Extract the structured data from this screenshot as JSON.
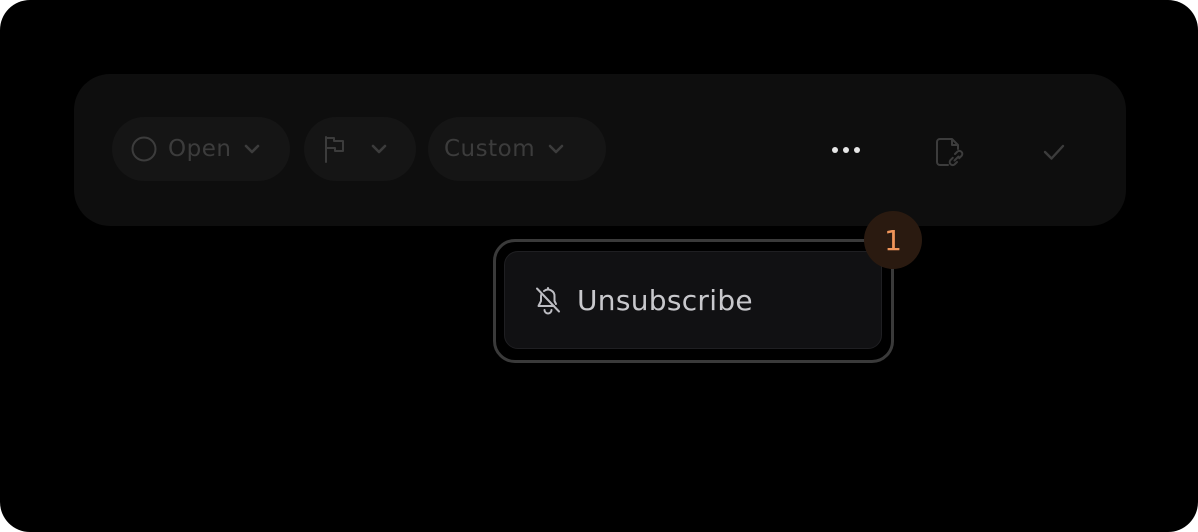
{
  "toolbar": {
    "status_label": "Open",
    "custom_label": "Custom"
  },
  "menu": {
    "items": [
      {
        "label": "Unsubscribe",
        "icon": "bell-off-icon"
      }
    ]
  },
  "badge": {
    "count": "1"
  },
  "colors": {
    "background": "#000000",
    "toolbar": "#0e0e0e",
    "pill": "#151515",
    "menu": "#111113",
    "badge_bg": "#2a1a10",
    "badge_text": "#f0955a"
  }
}
